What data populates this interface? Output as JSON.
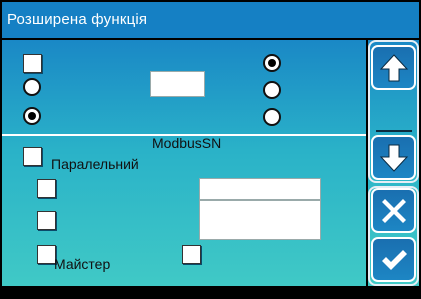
{
  "window": {
    "title": "Розширена функція"
  },
  "labels": {
    "modbus_sn": "ModbusSN",
    "parallel": "Паралельний",
    "master": "Майстер"
  },
  "colors": {
    "title_bar": "#1580c4",
    "panel_top": "#1a88c6",
    "panel_bottom": "#40c9c6",
    "background": "#000000"
  },
  "radio_groups": {
    "left": [
      {
        "selected": false
      },
      {
        "selected": true
      }
    ],
    "right": [
      {
        "selected": true
      },
      {
        "selected": false
      },
      {
        "selected": false
      }
    ]
  },
  "checkboxes": {
    "top": {
      "checked": false
    },
    "parallel": {
      "checked": false
    },
    "row2": {
      "checked": false
    },
    "row3": {
      "checked": false
    },
    "master": {
      "checked": false
    },
    "master_right": {
      "checked": false
    }
  },
  "sidebar": {
    "buttons": [
      {
        "name": "up",
        "icon": "arrow-up-icon"
      },
      {
        "name": "down",
        "icon": "arrow-down-icon"
      },
      {
        "name": "cancel",
        "icon": "close-icon"
      },
      {
        "name": "confirm",
        "icon": "check-icon"
      }
    ]
  }
}
